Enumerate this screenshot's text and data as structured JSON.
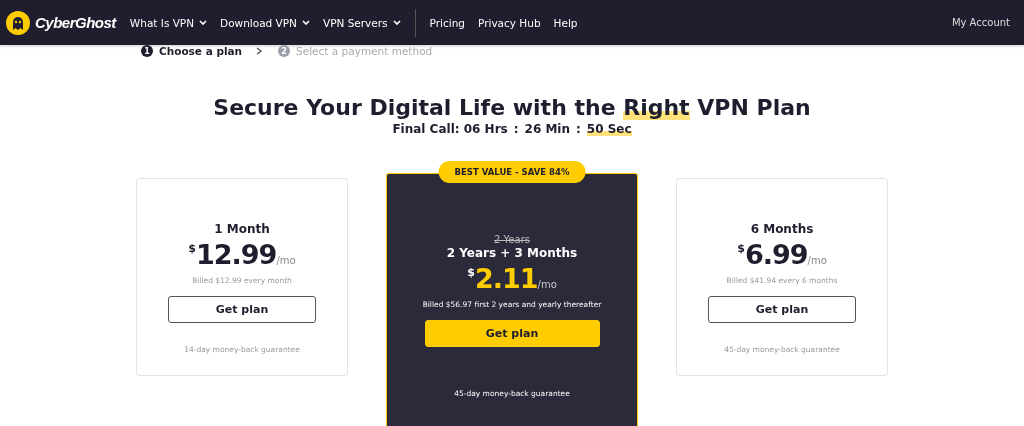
{
  "header": {
    "logo": "CyberGhost",
    "nav": [
      {
        "label": "What Is VPN",
        "dropdown": true
      },
      {
        "label": "Download VPN",
        "dropdown": true
      },
      {
        "label": "VPN Servers",
        "dropdown": true
      },
      {
        "label": "Pricing",
        "dropdown": false
      },
      {
        "label": "Privacy Hub",
        "dropdown": false
      },
      {
        "label": "Help",
        "dropdown": false
      }
    ],
    "account": "My Account"
  },
  "steps": [
    {
      "number": "1",
      "label": "Choose a plan",
      "selected": true
    },
    {
      "number": "2",
      "label": "Select a payment method",
      "selected": false
    }
  ],
  "headline": [
    {
      "text": "Secure Your Digital Life with the ",
      "highlighted": false
    },
    {
      "text": "Right",
      "highlighted": true
    },
    {
      "text": " VPN Plan",
      "highlighted": false
    }
  ],
  "countdown": [
    {
      "text": "Final Call: 06 Hrs",
      "highlighted": false
    },
    {
      "text": ":",
      "highlighted": false
    },
    {
      "text": "26 Min",
      "highlighted": false
    },
    {
      "text": ":",
      "highlighted": false
    },
    {
      "text": "50 Sec",
      "highlighted": true
    }
  ],
  "plans": [
    {
      "kind": "standard",
      "term": "1 Month",
      "currency": "$",
      "price": "12.99",
      "unit": "/mo",
      "billing": "Billed $12.99 every month",
      "button": "Get plan",
      "guarantee": "14-day money-back guarantee"
    },
    {
      "kind": "featured",
      "badge": "BEST VALUE - SAVE 84%",
      "old_term": "2 Years",
      "term": "2 Years + 3 Months",
      "currency": "$",
      "price": "2.11",
      "unit": "/mo",
      "billing": "Billed $56.97 first 2 years and yearly thereafter",
      "button": "Get plan",
      "guarantee": "45-day money-back guarantee"
    },
    {
      "kind": "standard",
      "term": "6 Months",
      "currency": "$",
      "price": "6.99",
      "unit": "/mo",
      "billing": "Billed $41.94 every 6 months",
      "button": "Get plan",
      "guarantee": "45-day money-back guarantee"
    }
  ]
}
